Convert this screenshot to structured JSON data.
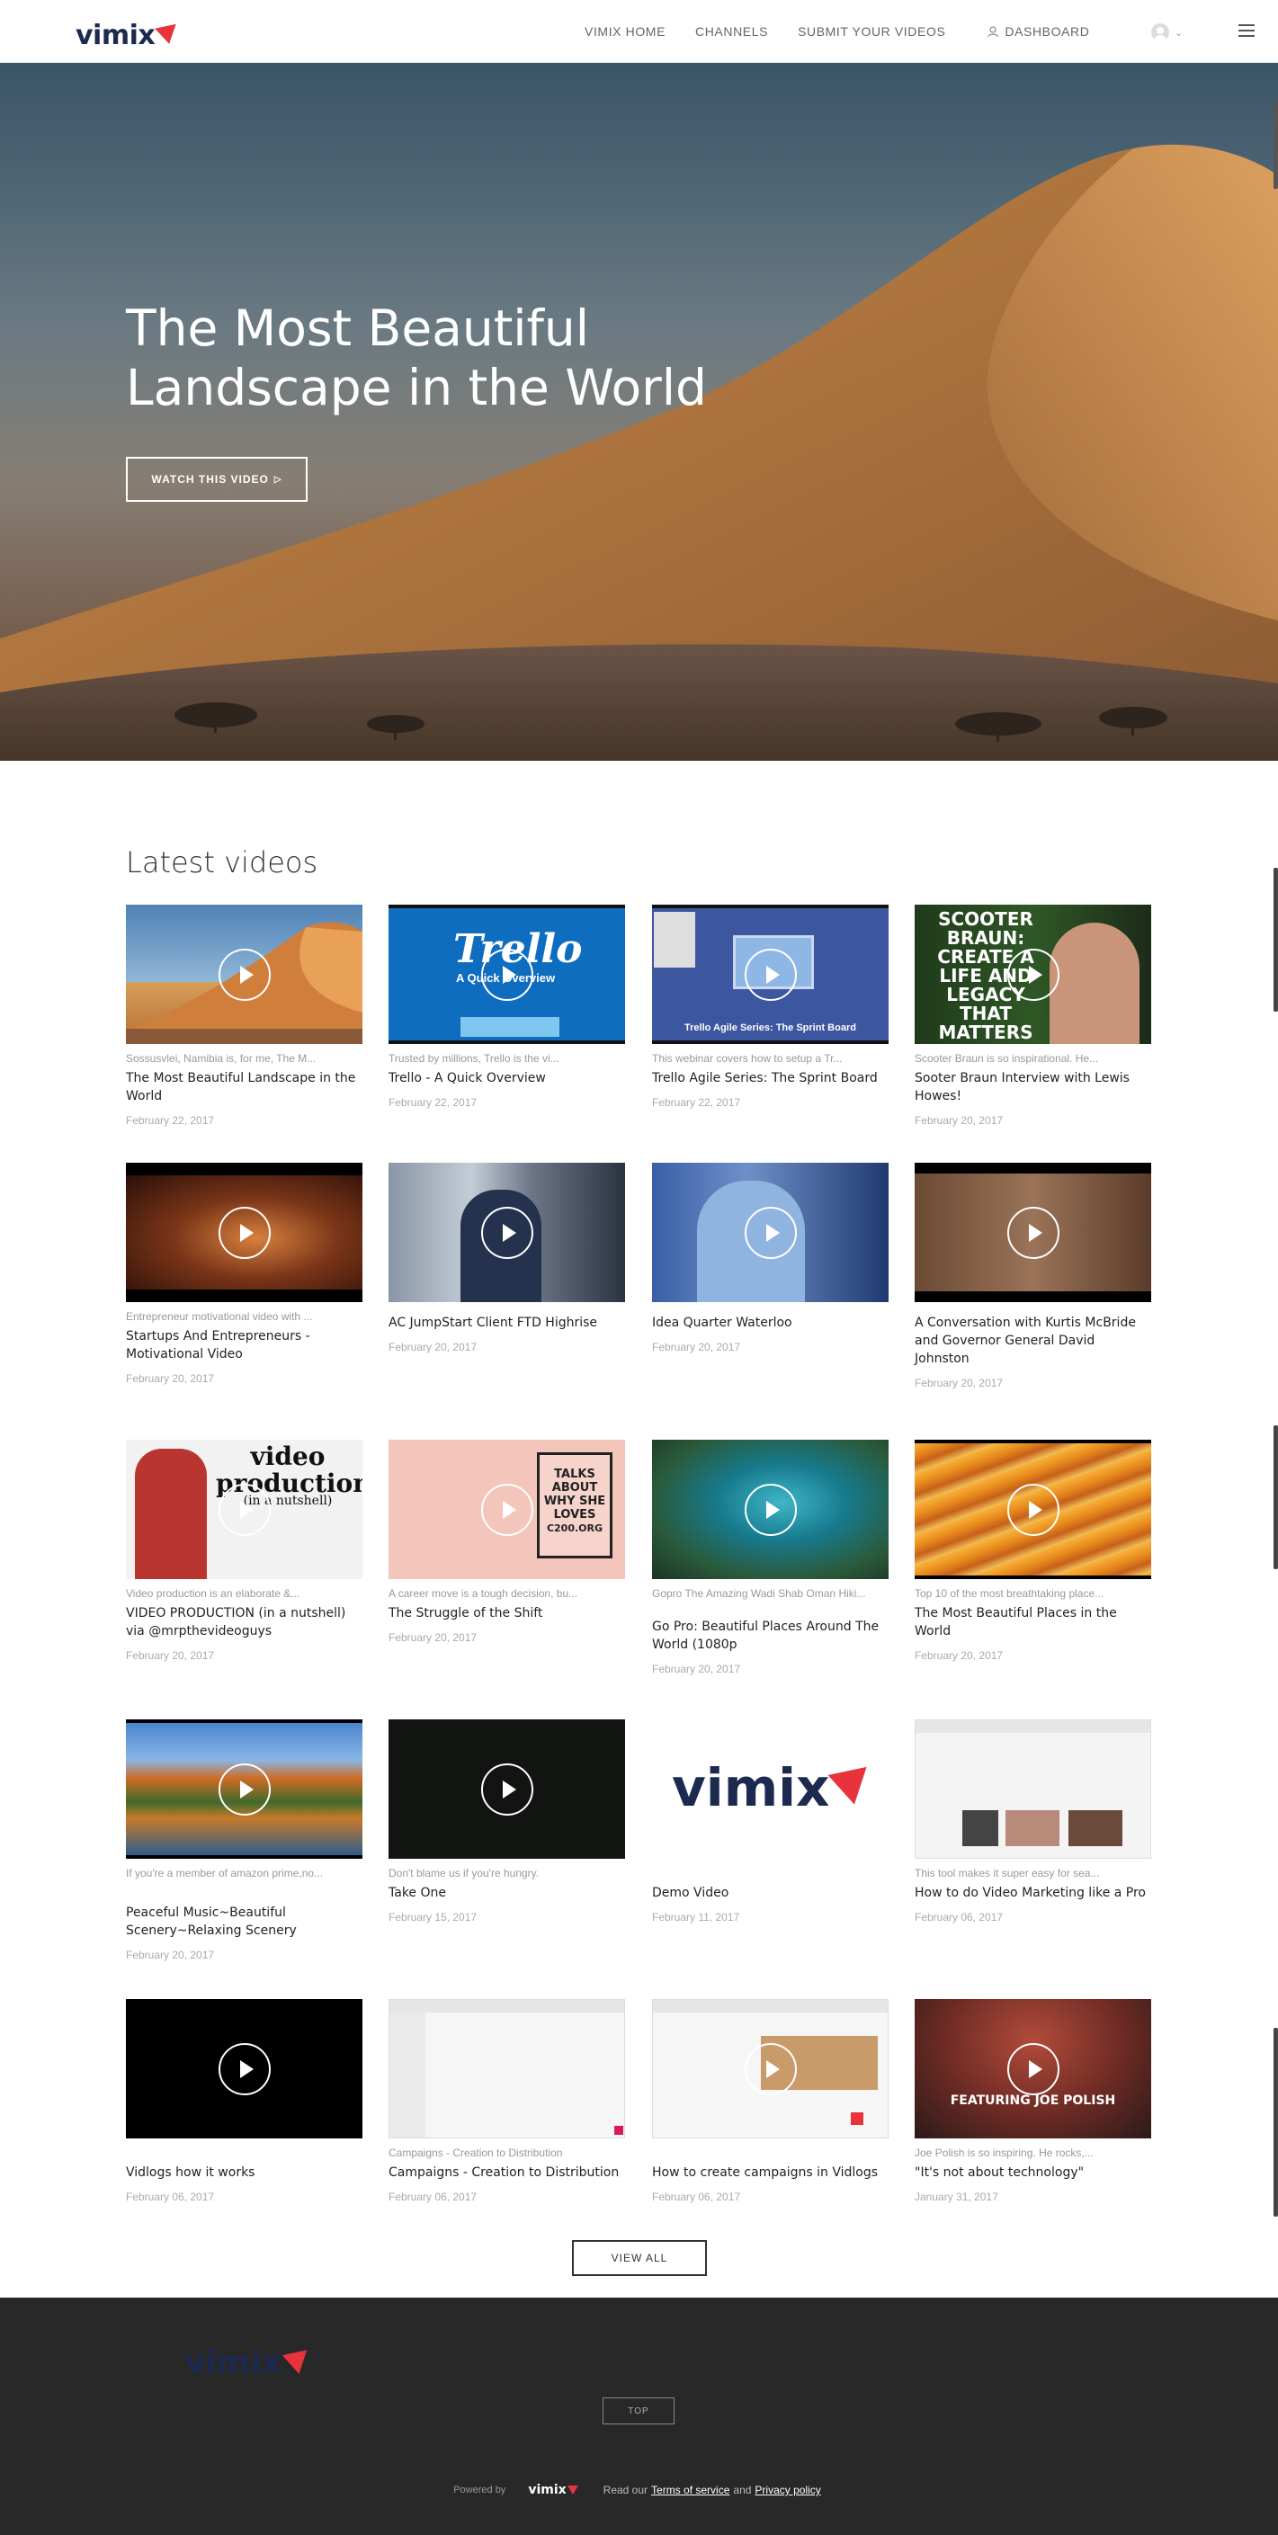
{
  "header": {
    "logo": "vimix",
    "nav": [
      "VIMIX HOME",
      "CHANNELS",
      "SUBMIT YOUR VIDEOS"
    ],
    "dashboard": "DASHBOARD"
  },
  "hero": {
    "title": "The Most Beautiful Landscape in the World",
    "button": "WATCH THIS VIDEO"
  },
  "latest": {
    "title": "Latest videos",
    "videos": [
      {
        "desc": "Sossusvlei, Namibia is, for me, The M...",
        "title": "The Most Beautiful Landscape in the World",
        "date": "February 22, 2017"
      },
      {
        "desc": "Trusted by millions, Trello is the vi...",
        "title": "Trello - A Quick Overview",
        "date": "February 22, 2017",
        "thumb_text": "Trello",
        "thumb_sub": "A Quick Overview"
      },
      {
        "desc": "This webinar covers how to setup a Tr...",
        "title": "Trello Agile Series: The Sprint Board",
        "date": "February 22, 2017",
        "thumb_text": "Trello Agile Series: The Sprint Board"
      },
      {
        "desc": "Scooter Braun is so inspirational. He...",
        "title": "Sooter Braun Interview with Lewis Howes!",
        "date": "February 20, 2017",
        "thumb_text": "SCOOTER BRAUN: CREATE A LIFE AND LEGACY THAT MATTERS"
      },
      {
        "desc": "Entrepreneur motivational video with ...",
        "title": "Startups And Entrepreneurs - Motivational Video",
        "date": "February 20, 2017"
      },
      {
        "desc": "",
        "title": "AC JumpStart Client FTD Highrise",
        "date": "February 20, 2017"
      },
      {
        "desc": "",
        "title": "Idea Quarter Waterloo",
        "date": "February 20, 2017"
      },
      {
        "desc": "",
        "title": "A Conversation with Kurtis McBride and Governor General David Johnston",
        "date": "February 20, 2017"
      },
      {
        "desc": "Video production is an elaborate &...",
        "title": "VIDEO PRODUCTION (in a nutshell) via @mrpthevideoguys",
        "date": "February 20, 2017",
        "thumb_text": "video production",
        "thumb_sub": "(in a nutshell)"
      },
      {
        "desc": "A career move is a tough decision, bu...",
        "title": "The Struggle of the Shift",
        "date": "February 20, 2017",
        "thumb_text": "TALKS ABOUT WHY SHE LOVES",
        "thumb_sub": "C200.ORG"
      },
      {
        "desc": "Gopro The Amazing Wadi Shab Oman Hiki...",
        "title": "Go Pro: Beautiful Places Around The World (1080p",
        "date": "February 20, 2017"
      },
      {
        "desc": "Top 10 of the most breathtaking place...",
        "title": "The Most Beautiful Places in the World",
        "date": "February 20, 2017"
      },
      {
        "desc": "If you're a member of amazon prime,no...",
        "title": "Peaceful Music~Beautiful Scenery~Relaxing Scenery",
        "date": "February 20, 2017"
      },
      {
        "desc": "Don't blame us if you're hungry.",
        "title": "Take One",
        "date": "February 15, 2017"
      },
      {
        "desc": "",
        "title": "Demo Video",
        "date": "February 11, 2017",
        "thumb_text": "vimix"
      },
      {
        "desc": "This tool makes it super easy for sea...",
        "title": "How to do Video Marketing like a Pro",
        "date": "February 06, 2017"
      },
      {
        "desc": "",
        "title": "Vidlogs how it works",
        "date": "February 06, 2017"
      },
      {
        "desc": "Campaigns - Creation to Distribution",
        "title": "Campaigns - Creation to Distribution",
        "date": "February 06, 2017"
      },
      {
        "desc": "",
        "title": "How to create campaigns in Vidlogs",
        "date": "February 06, 2017"
      },
      {
        "desc": "Joe Polish is so inspiring. He rocks,...",
        "title": "\"It's not about technology\"",
        "date": "January 31, 2017",
        "thumb_text": "FEATURING JOE POLISH"
      }
    ],
    "view_all": "VIEW ALL"
  },
  "footer": {
    "logo": "vimix",
    "top": "TOP",
    "powered_by": "Powered by",
    "mini_logo": "vimix",
    "read_our": "Read our",
    "terms": "Terms of service",
    "and": "and",
    "privacy": "Privacy policy"
  }
}
